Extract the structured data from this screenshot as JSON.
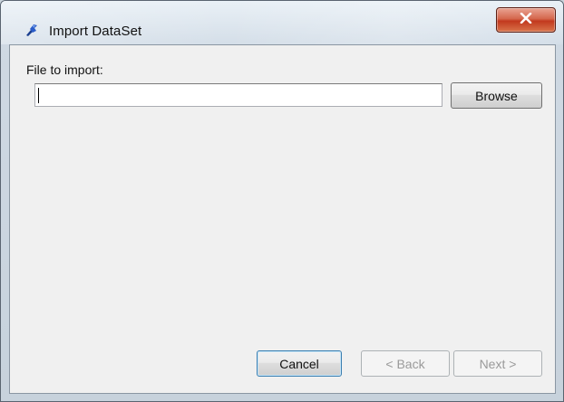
{
  "window": {
    "title": "Import DataSet",
    "close_label": "x"
  },
  "form": {
    "file_label": "File to import:",
    "file_value": "",
    "browse_label": "Browse"
  },
  "footer": {
    "cancel_label": "Cancel",
    "back_label": "< Back",
    "next_label": "Next >"
  },
  "icons": {
    "app": "import-wizard-icon",
    "close": "close-icon"
  },
  "colors": {
    "close_button": "#c7462a",
    "client_background": "#f0f0f0"
  }
}
